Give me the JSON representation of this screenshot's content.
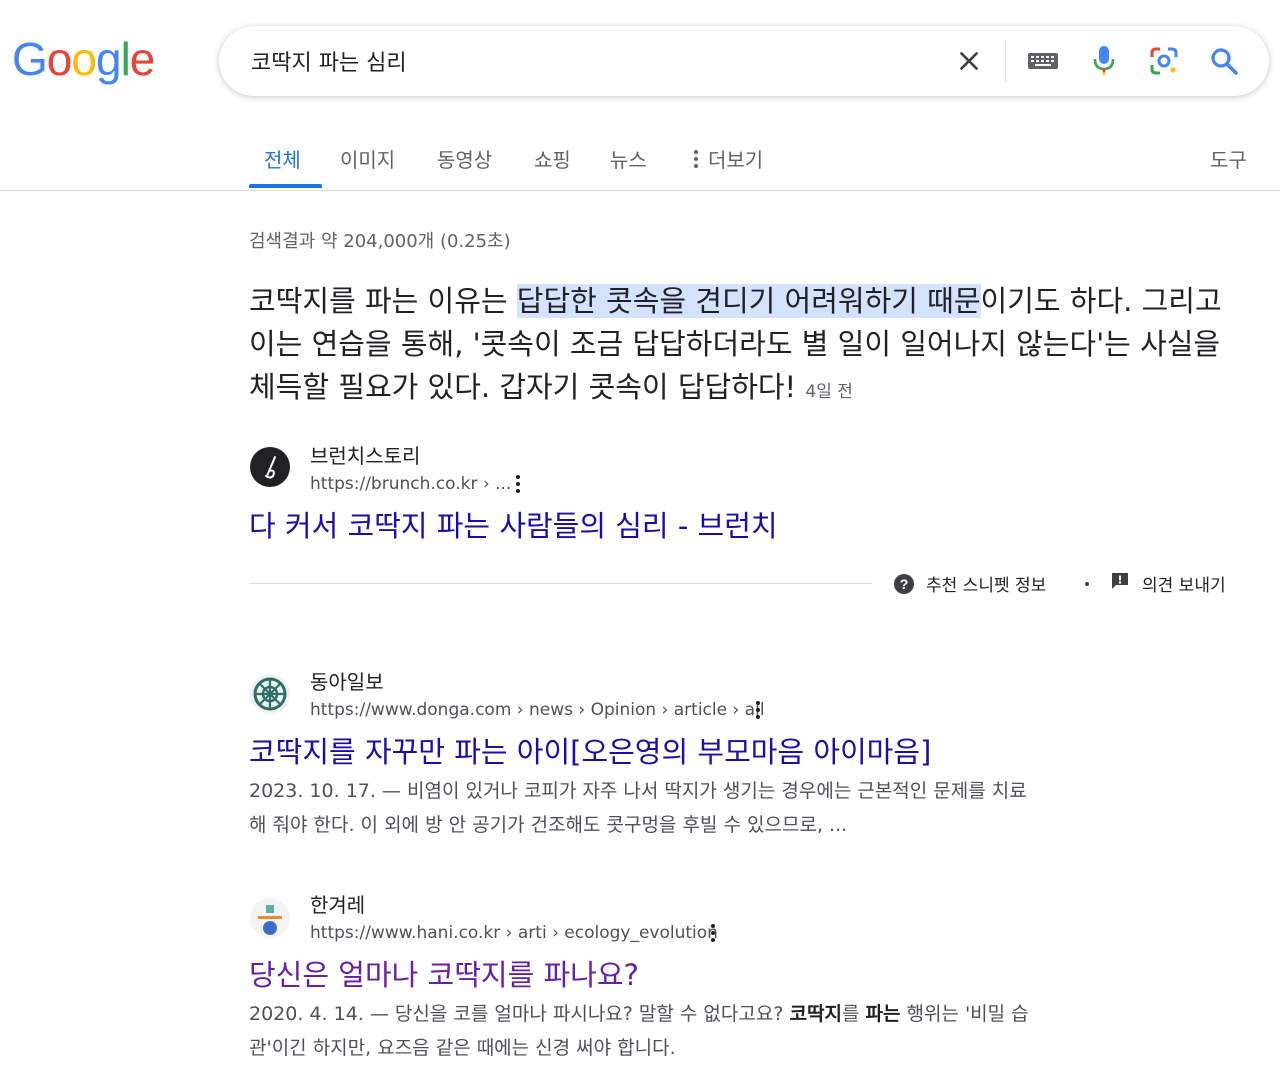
{
  "logo": {
    "letters": [
      "G",
      "o",
      "o",
      "g",
      "l",
      "e"
    ],
    "colors": [
      "#4285f4",
      "#ea4335",
      "#fbbc05",
      "#4285f4",
      "#34a853",
      "#ea4335"
    ]
  },
  "search": {
    "query": "코딱지 파는 심리"
  },
  "search_icons": [
    "clear-icon",
    "keyboard-icon",
    "microphone-icon",
    "lens-icon",
    "search-icon"
  ],
  "tabs": [
    {
      "label": "전체",
      "active": true
    },
    {
      "label": "이미지"
    },
    {
      "label": "동영상"
    },
    {
      "label": "쇼핑"
    },
    {
      "label": "뉴스"
    },
    {
      "label": "더보기"
    }
  ],
  "tools_label": "도구",
  "result_stats": "검색결과 약 204,000개 (0.25초)",
  "featured_snippet": {
    "text_before": "코딱지를 파는 이유는 ",
    "text_highlight": "답답한 콧속을 견디기 어려워하기 때문",
    "text_after": "이기도 하다. 그리고 이는 연습을 통해, '콧속이 조금 답답하더라도 별 일이 일어나지 않는다'는 사실을 체득할 필요가 있다. 갑자기 콧속이 답답하다!",
    "date": "4일 전",
    "site_name": "브런치스토리",
    "url": "https://brunch.co.kr › ...",
    "title": "다 커서 코딱지 파는 사람들의 심리 - 브런치",
    "about_label": "추천 스니펫 정보",
    "feedback_label": "의견 보내기"
  },
  "results": [
    {
      "site_name": "동아일보",
      "url": "https://www.donga.com › news › Opinion › article › all",
      "title": "코딱지를 자꾸만 파는 아이[오은영의 부모마음 아이마음]",
      "desc_date": "2023. 10. 17. — ",
      "desc_line1": "비염이 있거나 코피가 자주 나서 딱지가 생기는 경우에는 근본적인 문제를 치료",
      "desc_line2": "해 줘야 한다. 이 외에 방 안 공기가 건조해도 콧구멍을 후빌 수 있으므로, ..."
    },
    {
      "site_name": "한겨레",
      "url": "https://www.hani.co.kr › arti › ecology_evolution",
      "title": "당신은 얼마나 코딱지를 파나요?",
      "desc_date": "2020. 4. 14. — ",
      "desc_pre": "당신을 코를 얼마나 파시나요? 말할 수 없다고요? ",
      "desc_bold1": "코딱지",
      "desc_mid": "를 ",
      "desc_bold2": "파는",
      "desc_post": " 행위는 '비밀 습",
      "desc_line2": "관'이긴 하지만, 요즈음 같은 때에는 신경 써야 합니다."
    }
  ]
}
